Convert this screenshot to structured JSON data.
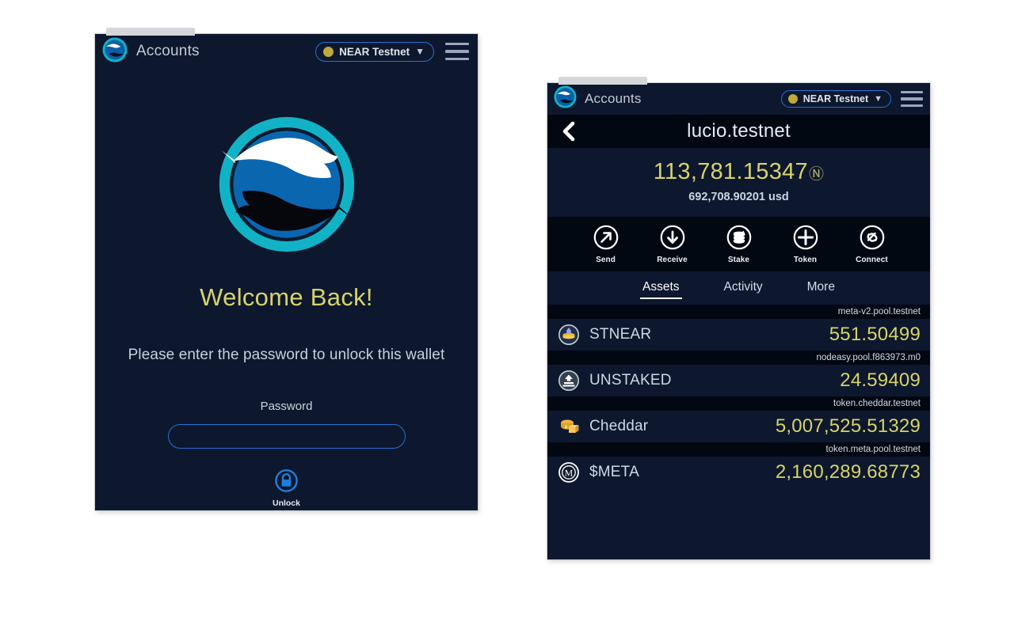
{
  "unlock_window": {
    "topbar": {
      "logo_icon": "narwhal-logo-icon",
      "title": "Accounts",
      "network": {
        "label": "NEAR Testnet",
        "dot_color": "#bfa83c",
        "chevron_icon": "chevron-down-icon"
      },
      "menu_icon": "hamburger-menu-icon"
    },
    "welcome_heading": "Welcome Back!",
    "subtitle": "Please enter the password to unlock this wallet",
    "password_label": "Password",
    "password_value": "",
    "password_placeholder": "",
    "unlock_button": {
      "label": "Unlock",
      "icon": "lock-icon"
    }
  },
  "account_window": {
    "topbar": {
      "logo_icon": "narwhal-logo-icon",
      "title": "Accounts",
      "network": {
        "label": "NEAR Testnet",
        "dot_color": "#bfa83c",
        "chevron_icon": "chevron-down-icon"
      },
      "menu_icon": "hamburger-menu-icon"
    },
    "account_header": {
      "back_icon": "back-chevron-icon",
      "account_name": "lucio.testnet"
    },
    "balance": {
      "amount": "113,781.15347",
      "symbol": "Ⓝ",
      "usd": "692,708.90201 usd"
    },
    "actions": [
      {
        "label": "Send",
        "icon": "arrow-up-right-icon"
      },
      {
        "label": "Receive",
        "icon": "arrow-down-icon"
      },
      {
        "label": "Stake",
        "icon": "coin-stack-icon"
      },
      {
        "label": "Token",
        "icon": "plus-icon"
      },
      {
        "label": "Connect",
        "icon": "link-icon"
      }
    ],
    "tabs": [
      {
        "label": "Assets",
        "active": true
      },
      {
        "label": "Activity",
        "active": false
      },
      {
        "label": "More",
        "active": false
      }
    ],
    "assets": [
      {
        "contract": "meta-v2.pool.testnet",
        "symbol": "STNEAR",
        "amount": "551.50499",
        "icon": "stnear-token-icon"
      },
      {
        "contract": "nodeasy.pool.f863973.m0",
        "symbol": "UNSTAKED",
        "amount": "24.59409",
        "icon": "unstaked-token-icon"
      },
      {
        "contract": "token.cheddar.testnet",
        "symbol": "Cheddar",
        "amount": "5,007,525.51329",
        "icon": "cheddar-token-icon"
      },
      {
        "contract": "token.meta.pool.testnet",
        "symbol": "$META",
        "amount": "2,160,289.68773",
        "icon": "meta-token-icon"
      }
    ]
  },
  "theme": {
    "panel_bg": "#0d182e",
    "panel_dark_bg": "#020811",
    "accent_gold": "#d8d36a",
    "accent_blue": "#2a6fd4",
    "text_primary": "#e6ecf6"
  }
}
